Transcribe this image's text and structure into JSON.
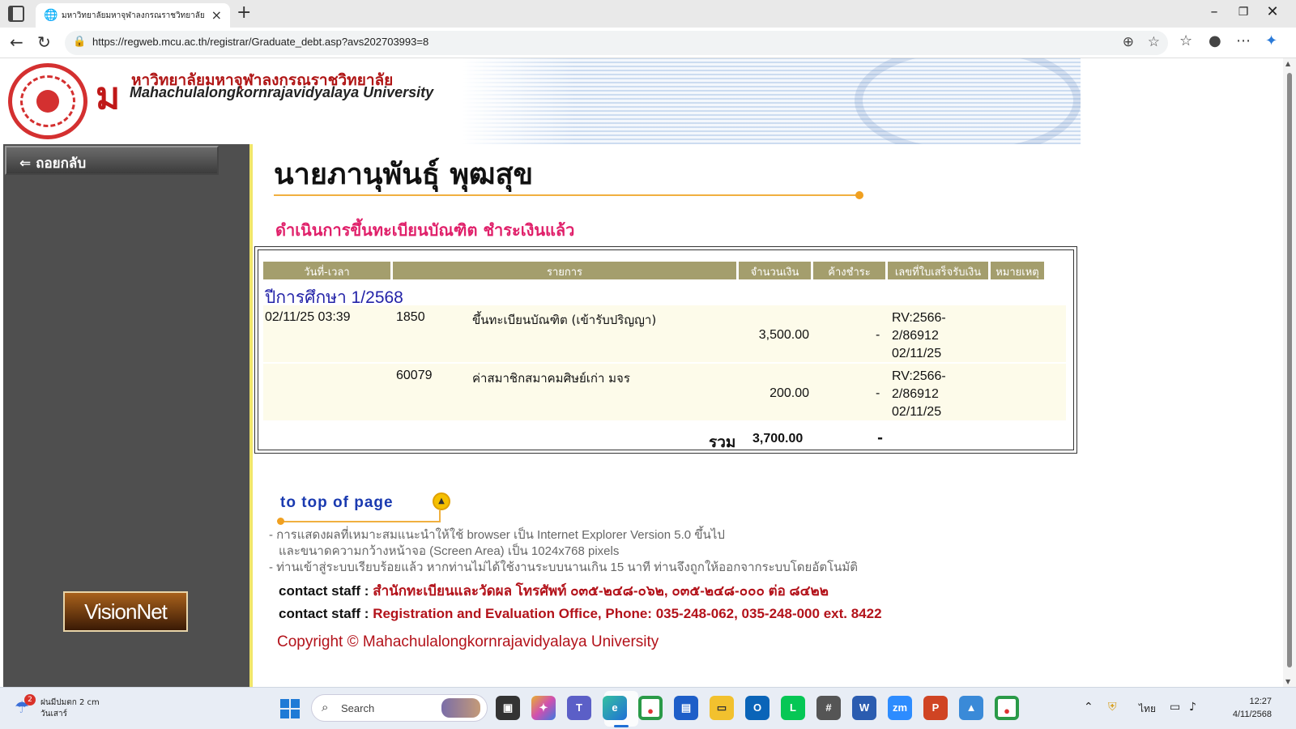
{
  "browser": {
    "tab_title": "มหาวิทยาลัยมหาจุฬาลงกรณราชวิทยาลัย",
    "url": "https://regweb.mcu.ac.th/registrar/Graduate_debt.asp?avs202703993=8"
  },
  "header": {
    "logo_thai": "หาวิทยาลัยมหาจุฬาลงกรณราชวิทยาลัย",
    "logo_en": "Mahachulalongkornrajavidyalaya University"
  },
  "sidebar": {
    "back_label": "ถอยกลับ",
    "banner_label": "VisionNet"
  },
  "main": {
    "student_name": "นายภานุพันธุ์ พุฒสุข",
    "status": "ดำเนินการขึ้นทะเบียนบัณฑิต ชำระเงินแล้ว"
  },
  "fees": {
    "headers": [
      "วันที่-เวลา",
      "รายการ",
      "จำนวนเงิน",
      "ค้างชำระ",
      "เลขที่ใบเสร็จรับเงิน",
      "หมายเหตุ"
    ],
    "year_label": "ปีการศึกษา 1/2568",
    "rows": [
      {
        "datetime": "02/11/25 03:39",
        "code": "1850",
        "description": "ขึ้นทะเบียนบัณฑิต (เข้ารับปริญญา)",
        "amount": "3,500.00",
        "outstanding": "-",
        "receipt": [
          "RV:2566-",
          "2/86912",
          "02/11/25"
        ]
      },
      {
        "datetime": "",
        "code": "60079",
        "description": "ค่าสมาชิกสมาคมศิษย์เก่า มจร",
        "amount": "200.00",
        "outstanding": "-",
        "receipt": [
          "RV:2566-",
          "2/86912",
          "02/11/25"
        ]
      }
    ],
    "total_label": "รวม",
    "total_amount": "3,700.00",
    "total_outstanding": "-"
  },
  "footer": {
    "top_link": "to top of page",
    "notes": [
      "- การแสดงผลที่เหมาะสมแนะนำให้ใช้ browser เป็น Internet Explorer Version 5.0 ขึ้นไป",
      "และขนาดความกว้างหน้าจอ (Screen Area) เป็น 1024x768 pixels",
      "- ท่านเข้าสู่ระบบเรียบร้อยแล้ว หากท่านไม่ได้ใช้งานระบบนานเกิน 15 นาที ท่านจึงถูกให้ออกจากระบบโดยอัตโนมัติ"
    ],
    "contact_label": "contact staff :",
    "contact_thai": "สำนักทะเบียนและวัดผล โทรศัพท์ ๐๓๕-๒๔๘-๐๖๒, ๐๓๕-๒๔๘-๐๐๐ ต่อ ๘๔๒๒",
    "contact_en": "Registration and Evaluation Office, Phone: 035-248-062, 035-248-000 ext. 8422",
    "copyright": "Copyright © Mahachulalongkornrajavidyalaya University"
  },
  "taskbar": {
    "weather_badge": "2",
    "weather_line1": "ฝนมีปมตก 2 cm",
    "weather_line2": "วันเสาร์",
    "search_placeholder": "Search",
    "language": "ไทย",
    "time": "12:27",
    "date": "4/11/2568"
  },
  "colors": {
    "header_row": "#a49e6d",
    "status_pink": "#e0206a",
    "contact_red": "#b3121a",
    "sidebar_gray": "#4f4f4f"
  }
}
